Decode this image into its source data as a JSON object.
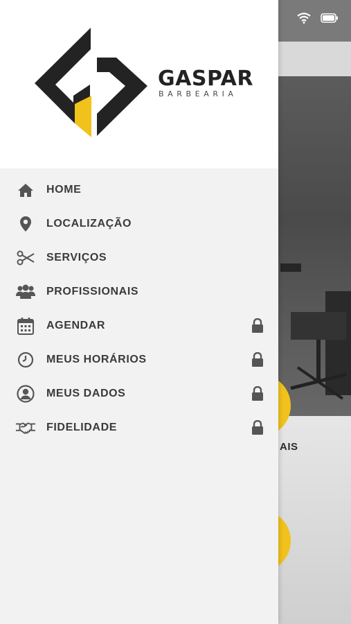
{
  "background": {
    "partial_text": "AIS"
  },
  "drawer": {
    "brand": {
      "name": "GASPAR",
      "subtitle": "BARBEARIA"
    },
    "menu": [
      {
        "label": "HOME",
        "icon": "home-icon",
        "locked": false
      },
      {
        "label": "LOCALIZAÇÃO",
        "icon": "map-pin-icon",
        "locked": false
      },
      {
        "label": "SERVIÇOS",
        "icon": "scissors-icon",
        "locked": false
      },
      {
        "label": "PROFISSIONAIS",
        "icon": "users-icon",
        "locked": false
      },
      {
        "label": "AGENDAR",
        "icon": "calendar-icon",
        "locked": true
      },
      {
        "label": "MEUS HORÁRIOS",
        "icon": "clock-icon",
        "locked": true
      },
      {
        "label": "MEUS DADOS",
        "icon": "user-circle-icon",
        "locked": true
      },
      {
        "label": "FIDELIDADE",
        "icon": "handshake-icon",
        "locked": true
      }
    ]
  },
  "colors": {
    "accent": "#f1c21b",
    "icon": "#555555",
    "text": "#3a3a3a",
    "drawer_bg": "#f2f2f2"
  }
}
